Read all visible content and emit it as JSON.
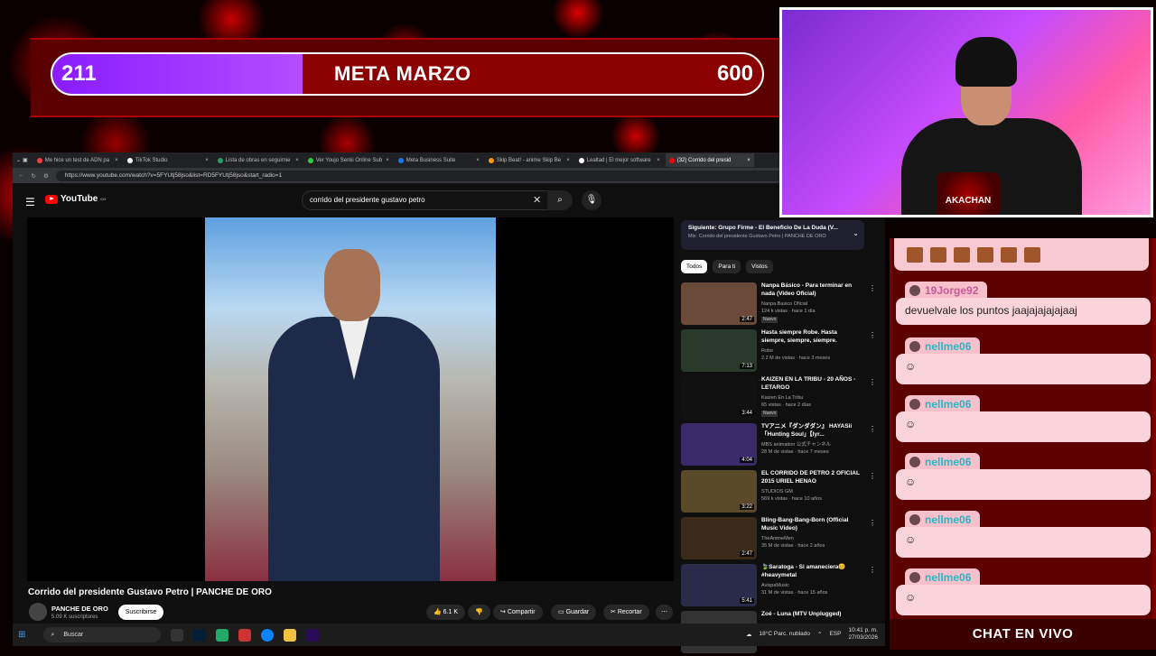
{
  "goal": {
    "current": "211",
    "title": "META MARZO",
    "target": "600",
    "progress_fraction": 0.352
  },
  "browser": {
    "tabs": [
      {
        "label": "Me hice un test de ADN pa",
        "color": "#ff3b3b"
      },
      {
        "label": "TikTok Studio",
        "color": "#ffffff"
      },
      {
        "label": "Lista de obras en seguimie",
        "color": "#1fa463"
      },
      {
        "label": "Ver Youjo Senki Online Sub",
        "color": "#2ecc40"
      },
      {
        "label": "Meta Business Suite",
        "color": "#1877f2"
      },
      {
        "label": "Skip Beat! - anime Skip Be",
        "color": "#ff9800"
      },
      {
        "label": "Lealtad | El mejor software",
        "color": "#ffffff"
      },
      {
        "label": "(32) Corrido del presid",
        "color": "#ff0000"
      }
    ],
    "url": "https://www.youtube.com/watch?v=5FYUtj58jso&list=RD5FYUtj58jso&start_radio=1"
  },
  "youtube": {
    "logo": "YouTube",
    "country": "CO",
    "search_query": "corrido del presidente gustavo petro",
    "video_title": "Corrido del presidente Gustavo Petro | PANCHE DE ORO",
    "channel": "PANCHE DE ORO",
    "subscribers": "5.09 K suscriptores",
    "subscribe": "Suscribirse",
    "likes": "6.1 K",
    "share": "Compartir",
    "save": "Guardar",
    "clip": "Recortar",
    "next_title": "Siguiente: Grupo Firme - El Beneficio De La Duda (V...",
    "next_sub": "Mix: Corrido del presidente Gustavo Petro | PANCHE DE ORO",
    "chips": [
      "Todos",
      "Para ti",
      "Vistos"
    ],
    "recommendations": [
      {
        "title": "Nanpa Básico - Para terminar en nada (Video Oficial)",
        "channel": "Nanpa Basico Oficial",
        "meta": "124 k vistas · hace 1 día",
        "badge": "Nuevo",
        "duration": "2:47"
      },
      {
        "title": "Hasta siempre Robe. Hasta siempre, siempre, siempre.",
        "channel": "Robe",
        "meta": "2.2 M de vistas · hace 3 meses",
        "badge": "",
        "duration": "7:13"
      },
      {
        "title": "KAIZEN EN LA TRIBU - 20 AÑOS - LETARGO",
        "channel": "Kaizen En La Tribu",
        "meta": "65 vistas · hace 2 días",
        "badge": "Nuevo",
        "duration": "3:44"
      },
      {
        "title": "TVアニメ『ダンダダン』 HAYASii「Hunting Soul」【lyr...",
        "channel": "MBS animation 公式チャンネル",
        "meta": "28 M de vistas · hace 7 meses",
        "badge": "",
        "duration": "4:04"
      },
      {
        "title": "EL CORRIDO DE PETRO 2 OFICIAL 2015 URIEL HENAO",
        "channel": "STUDIOS GM",
        "meta": "569 k vistas · hace 10 años",
        "badge": "",
        "duration": "3:22"
      },
      {
        "title": "Bling-Bang-Bang-Born (Official Music Video)",
        "channel": "TheAnimeMen",
        "meta": "35 M de vistas · hace 2 años",
        "badge": "",
        "duration": "2:47"
      },
      {
        "title": "🍃Saratoga - Si amaneciera😊 #heavymetal",
        "channel": "AvispaMusic",
        "meta": "31 M de vistas · hace 15 años",
        "badge": "",
        "duration": "5:41"
      },
      {
        "title": "Zoé - Luna (MTV Unplugged)",
        "channel": "",
        "meta": "",
        "badge": "",
        "duration": ""
      }
    ]
  },
  "taskbar": {
    "search": "Buscar",
    "weather": "18°C  Parc. nublado",
    "lang": "ESP",
    "time": "10:41 p. m.",
    "date": "27/03/2026"
  },
  "cam": {
    "badge": "AKACHAN",
    "badge_top": "NACIÓN"
  },
  "chat": {
    "messages": [
      {
        "user": "19Jorge92",
        "text": "devuelvale los puntos jaajajajajajaaj"
      },
      {
        "user": "nellme06",
        "text": ""
      },
      {
        "user": "nellme06",
        "text": ""
      },
      {
        "user": "nellme06",
        "text": ""
      },
      {
        "user": "nellme06",
        "text": ""
      },
      {
        "user": "nellme06",
        "text": ""
      }
    ],
    "footer": "CHAT EN VIVO"
  }
}
